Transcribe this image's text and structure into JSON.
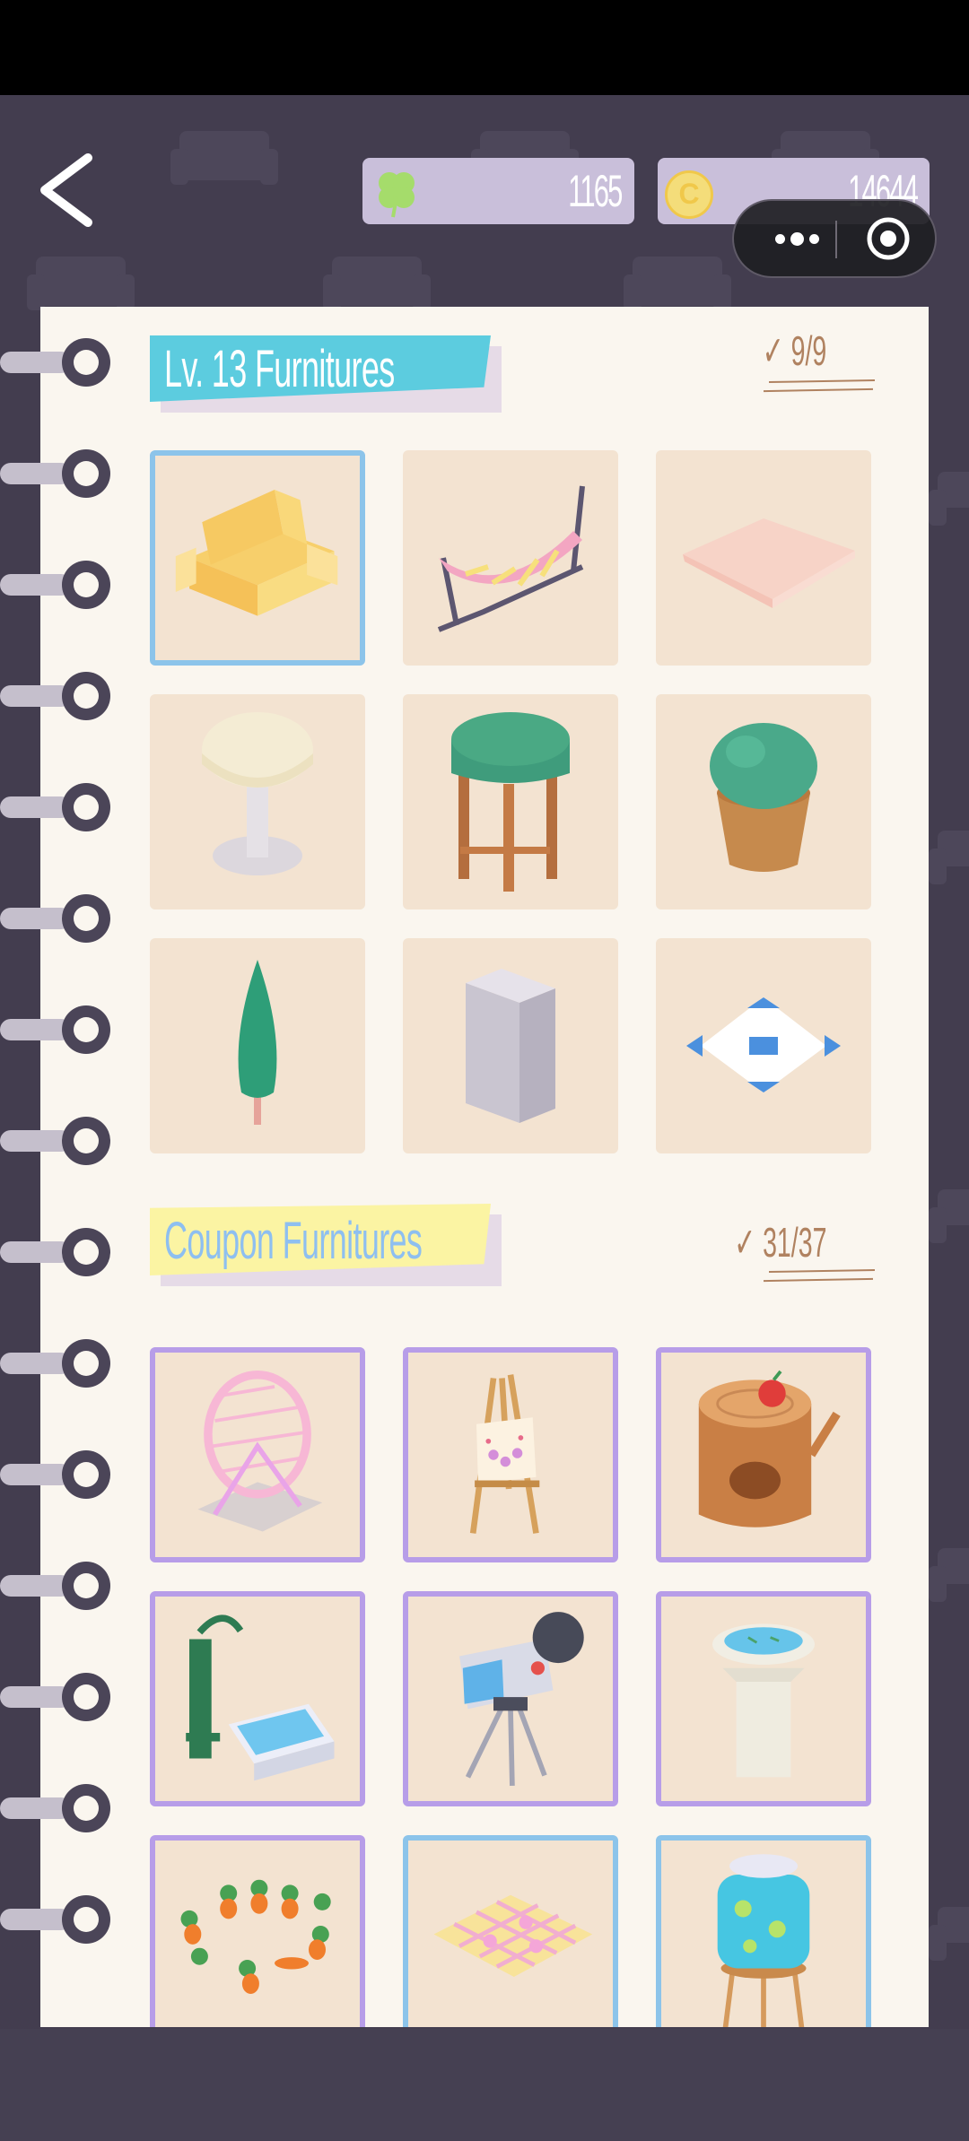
{
  "top_bar": {
    "back_icon": "chevron-left-icon",
    "clover_count": "1165",
    "coin_count": "14644",
    "coin_symbol": "C"
  },
  "section_level": {
    "title": "Lv. 13 Furnitures",
    "progress": "✓ 9/9",
    "ribbon_color": "#5cccdf",
    "items": [
      "sofa",
      "hammock",
      "floor-cushion",
      "round-side-table",
      "bar-stool",
      "potted-bush",
      "cypress-tree",
      "gray-block",
      "blue-diamond-tile"
    ]
  },
  "section_coupon": {
    "title": "Coupon Furnitures",
    "progress": "✓ 31/37",
    "ribbon_color": "#fbf4a3",
    "items": [
      "hamster-wheel",
      "painting-easel",
      "tree-stump-house",
      "water-pump",
      "video-camera",
      "bird-bath",
      "carrot-patch",
      "picnic-blanket",
      "drink-dispenser"
    ]
  },
  "colors": {
    "blue_frame": "#8cc4ea",
    "purple_frame": "#b79de8",
    "tile_bg": "#f3e3d1",
    "page_bg": "#faf6ef",
    "background": "#433d4f"
  }
}
